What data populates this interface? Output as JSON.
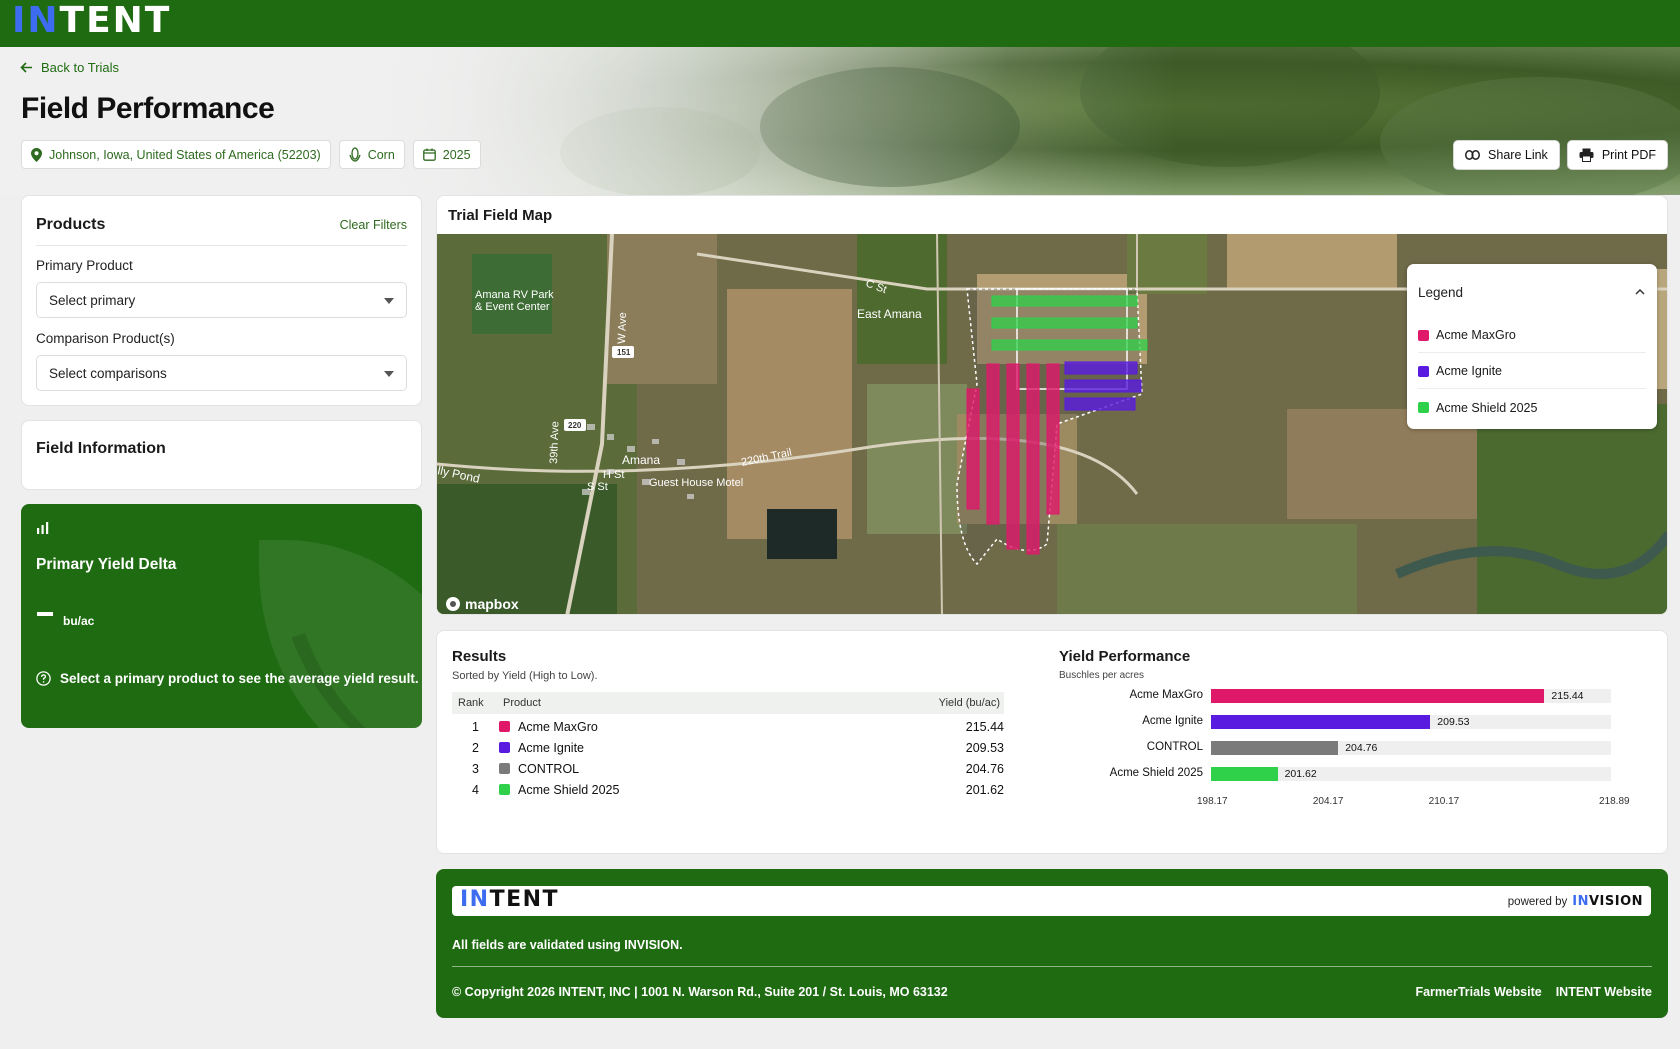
{
  "brand": {
    "logo_in": "IN",
    "logo_rest": "TENT",
    "primary_color": "#1f6b12",
    "accent_color": "#3d6cf0"
  },
  "nav": {
    "back_label": "Back to Trials"
  },
  "page": {
    "title": "Field Performance"
  },
  "chips": {
    "location": "Johnson, Iowa, United States of America (52203)",
    "crop": "Corn",
    "year": "2025"
  },
  "actions": {
    "share": "Share Link",
    "print": "Print PDF"
  },
  "products": {
    "title": "Products",
    "clear": "Clear Filters",
    "primary_label": "Primary Product",
    "primary_value": "Select primary",
    "comparison_label": "Comparison Product(s)",
    "comparison_value": "Select comparisons"
  },
  "field_info": {
    "title": "Field Information"
  },
  "delta": {
    "title": "Primary Yield Delta",
    "unit": "bu/ac",
    "message": "Select a primary product to see the average yield result."
  },
  "map": {
    "title": "Trial Field Map",
    "attribution": "mapbox",
    "labels": [
      "Amana RV Park & Event Center",
      "East Amana",
      "Amana",
      "Guest House Motel",
      "220th Trail",
      "lly Pond",
      "W Ave",
      "39th Ave",
      "C St",
      "H St",
      "S St"
    ],
    "road_shields": [
      "151",
      "220"
    ],
    "legend": {
      "title": "Legend",
      "items": [
        {
          "name": "Acme MaxGro",
          "color": "#e0186a"
        },
        {
          "name": "Acme Ignite",
          "color": "#5a1be0"
        },
        {
          "name": "Acme Shield 2025",
          "color": "#2fd04a"
        }
      ]
    }
  },
  "results": {
    "title": "Results",
    "subtitle": "Sorted by Yield (High to Low).",
    "columns": [
      "Rank",
      "Product",
      "Yield (bu/ac)"
    ],
    "rows": [
      {
        "rank": "1",
        "product": "Acme MaxGro",
        "yield": "215.44",
        "color": "#e0186a"
      },
      {
        "rank": "2",
        "product": "Acme Ignite",
        "yield": "209.53",
        "color": "#5a1be0"
      },
      {
        "rank": "3",
        "product": "CONTROL",
        "yield": "204.76",
        "color": "#7a7a7a"
      },
      {
        "rank": "4",
        "product": "Acme Shield 2025",
        "yield": "201.62",
        "color": "#2fd04a"
      }
    ]
  },
  "yield_chart": {
    "title": "Yield Performance",
    "subtitle": "Buschles per acres"
  },
  "chart_data": {
    "type": "bar",
    "orientation": "horizontal",
    "title": "Yield Performance",
    "subtitle": "Buschles per acres",
    "categories": [
      "Acme MaxGro",
      "Acme Ignite",
      "CONTROL",
      "Acme Shield 2025"
    ],
    "values": [
      215.44,
      209.53,
      204.76,
      201.62
    ],
    "colors": [
      "#e0186a",
      "#5a1be0",
      "#7a7a7a",
      "#2fd04a"
    ],
    "xlim": [
      198.17,
      218.89
    ],
    "xticks": [
      "198.17",
      "204.17",
      "210.17",
      "218.89"
    ]
  },
  "footer": {
    "logo_in": "IN",
    "logo_rest": "TENT",
    "powered_by": "powered by",
    "invision_in": "IN",
    "invision_rest": "VISION",
    "note": "All fields are validated using INVISION.",
    "copyright": "© Copyright 2026 INTENT, INC | 1001 N. Warson Rd., Suite 201 / St. Louis, MO 63132",
    "links": [
      "FarmerTrials Website",
      "INTENT Website"
    ]
  }
}
